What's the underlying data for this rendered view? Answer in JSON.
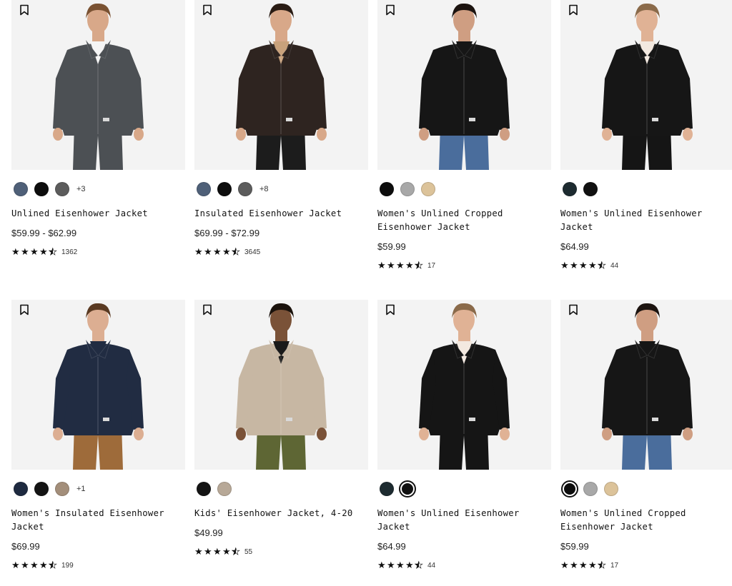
{
  "products": [
    {
      "name_line1": "Unlined Eisenhower Jacket",
      "name_line2": "",
      "price": "$59.99 - $62.99",
      "reviews": "1362",
      "more": "+3",
      "swatches": [
        "#4f6078",
        "#0d0d0d",
        "#5c5c5c"
      ],
      "selected": -1,
      "jacket": "#4c5054",
      "bottom": "#4c5054",
      "skin": "#d8a889",
      "hair": "#7a5232",
      "inner": "#f5f5f5",
      "icon": "bookmark-icon"
    },
    {
      "name_line1": "Insulated Eisenhower Jacket",
      "name_line2": "",
      "price": "$69.99 - $72.99",
      "reviews": "3645",
      "more": "+8",
      "swatches": [
        "#4f6078",
        "#0d0d0d",
        "#5c5c5c"
      ],
      "selected": -1,
      "jacket": "#2e2420",
      "bottom": "#1c1c1c",
      "skin": "#d8a889",
      "hair": "#2a1c14",
      "inner": "#c9a27c",
      "icon": "bookmark-icon"
    },
    {
      "name_line1": "Women's Unlined Cropped",
      "name_line2": "Eisenhower Jacket",
      "price": "$59.99",
      "reviews": "17",
      "more": "",
      "swatches": [
        "#0d0d0d",
        "#a8a8a8",
        "#dcc39a"
      ],
      "selected": -1,
      "jacket": "#161616",
      "bottom": "#4a6d9c",
      "skin": "#cf9e82",
      "hair": "#1c1410",
      "inner": "#161616",
      "icon": "bookmark-icon"
    },
    {
      "name_line1": "Women's Unlined Eisenhower",
      "name_line2": "Jacket",
      "price": "$64.99",
      "reviews": "44",
      "more": "",
      "swatches": [
        "#1d2b30",
        "#111111"
      ],
      "selected": -1,
      "jacket": "#161616",
      "bottom": "#151515",
      "skin": "#e0b295",
      "hair": "#8a6a4a",
      "inner": "#f3e9e0",
      "icon": "bookmark-icon"
    },
    {
      "name_line1": "Women's Insulated Eisenhower",
      "name_line2": "Jacket",
      "price": "$69.99",
      "reviews": "199",
      "more": "+1",
      "swatches": [
        "#1e2a40",
        "#141414",
        "#a38e7a"
      ],
      "selected": -1,
      "jacket": "#212c42",
      "bottom": "#9e6b3a",
      "skin": "#dcae92",
      "hair": "#5a3a22",
      "inner": "#212c42",
      "icon": "bookmark-icon"
    },
    {
      "name_line1": "Kids' Eisenhower Jacket, 4-20",
      "name_line2": "",
      "price": "$49.99",
      "reviews": "55",
      "more": "",
      "swatches": [
        "#141414",
        "#b7a897"
      ],
      "selected": -1,
      "jacket": "#c7b7a3",
      "bottom": "#5e6634",
      "skin": "#7a5238",
      "hair": "#1a120c",
      "inner": "#1a1a1a",
      "icon": "bookmark-icon"
    },
    {
      "name_line1": "Women's Unlined Eisenhower",
      "name_line2": "Jacket",
      "price": "$64.99",
      "reviews": "44",
      "more": "",
      "swatches": [
        "#1d2b30",
        "#111111"
      ],
      "selected": 1,
      "jacket": "#151515",
      "bottom": "#151515",
      "skin": "#e0b295",
      "hair": "#8a6a4a",
      "inner": "#f3e9e0",
      "icon": "bookmark-icon"
    },
    {
      "name_line1": "Women's Unlined Cropped",
      "name_line2": "Eisenhower Jacket",
      "price": "$59.99",
      "reviews": "17",
      "more": "",
      "swatches": [
        "#0d0d0d",
        "#a8a8a8",
        "#dcc39a"
      ],
      "selected": 0,
      "jacket": "#161616",
      "bottom": "#4a6d9c",
      "skin": "#cf9e82",
      "hair": "#1c1410",
      "inner": "#161616",
      "icon": "bookmark-icon"
    }
  ],
  "rating_value": 4.5
}
